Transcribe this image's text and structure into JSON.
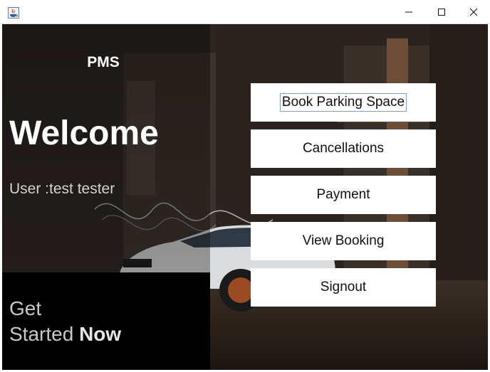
{
  "window": {
    "controls": [
      "minimize",
      "maximize",
      "close"
    ]
  },
  "sidebar": {
    "app_name": "PMS",
    "welcome": "Welcome",
    "user_label": "User :test tester",
    "get_started_line1": "Get",
    "get_started_line2": "Started",
    "get_started_emphasis": "Now"
  },
  "menu": {
    "book": "Book Parking Space",
    "cancellations": "Cancellations",
    "payment": "Payment",
    "view_booking": "View Booking",
    "signout": "Signout"
  },
  "colors": {
    "panel": "#000000",
    "button": "#ffffff",
    "text_light": "#ffffff"
  }
}
